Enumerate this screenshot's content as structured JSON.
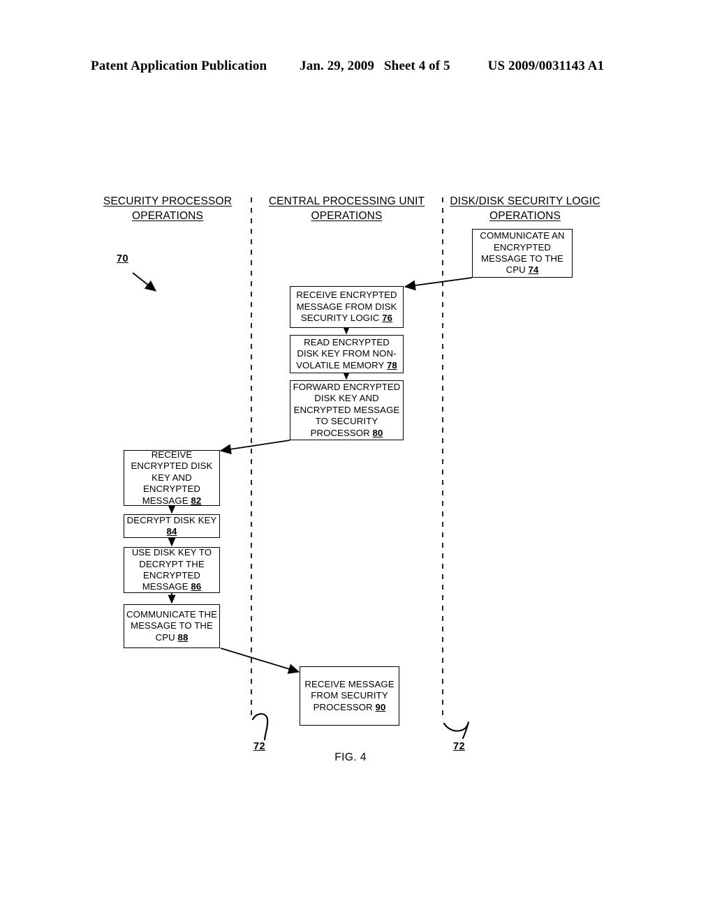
{
  "header": {
    "publication": "Patent Application Publication",
    "date": "Jan. 29, 2009",
    "sheet": "Sheet 4 of 5",
    "number": "US 2009/0031143 A1"
  },
  "figure": {
    "caption": "FIG. 4",
    "diagram_ref": "70",
    "break_ref_left": "72",
    "break_ref_right": "72",
    "lanes": [
      {
        "id": "security-processor",
        "line1": "SECURITY PROCESSOR",
        "line2": "OPERATIONS"
      },
      {
        "id": "central-processing-unit",
        "line1": "CENTRAL PROCESSING UNIT",
        "line2": "OPERATIONS"
      },
      {
        "id": "disk-security-logic",
        "line1": "DISK/DISK SECURITY LOGIC",
        "line2": "OPERATIONS"
      }
    ],
    "boxes": [
      {
        "ref": "74",
        "lane": "disk-security-logic",
        "lines": [
          "COMMUNICATE AN",
          "ENCRYPTED",
          "MESSAGE TO THE",
          "CPU"
        ]
      },
      {
        "ref": "76",
        "lane": "central-processing-unit",
        "lines": [
          "RECEIVE ENCRYPTED",
          "MESSAGE FROM DISK",
          "SECURITY LOGIC"
        ]
      },
      {
        "ref": "78",
        "lane": "central-processing-unit",
        "lines": [
          "READ ENCRYPTED",
          "DISK KEY FROM NON-",
          "VOLATILE MEMORY"
        ]
      },
      {
        "ref": "80",
        "lane": "central-processing-unit",
        "lines": [
          "FORWARD ENCRYPTED",
          "DISK KEY AND",
          "ENCRYPTED MESSAGE",
          "TO SECURITY",
          "PROCESSOR"
        ]
      },
      {
        "ref": "82",
        "lane": "security-processor",
        "lines": [
          "RECEIVE",
          "ENCRYPTED DISK",
          "KEY AND",
          "ENCRYPTED",
          "MESSAGE"
        ]
      },
      {
        "ref": "84",
        "lane": "security-processor",
        "lines": [
          "DECRYPT DISK KEY"
        ]
      },
      {
        "ref": "86",
        "lane": "security-processor",
        "lines": [
          "USE DISK KEY TO",
          "DECRYPT THE",
          "ENCRYPTED",
          "MESSAGE"
        ]
      },
      {
        "ref": "88",
        "lane": "security-processor",
        "lines": [
          "COMMUNICATE THE",
          "MESSAGE TO THE",
          "CPU"
        ]
      },
      {
        "ref": "90",
        "lane": "central-processing-unit",
        "lines": [
          "RECEIVE MESSAGE",
          "FROM SECURITY",
          "PROCESSOR"
        ]
      }
    ],
    "flow": [
      {
        "from": "74",
        "to": "76",
        "kind": "cross-lane"
      },
      {
        "from": "76",
        "to": "78",
        "kind": "vertical"
      },
      {
        "from": "78",
        "to": "80",
        "kind": "vertical"
      },
      {
        "from": "80",
        "to": "82",
        "kind": "cross-lane"
      },
      {
        "from": "82",
        "to": "84",
        "kind": "vertical"
      },
      {
        "from": "84",
        "to": "86",
        "kind": "vertical"
      },
      {
        "from": "86",
        "to": "88",
        "kind": "vertical"
      },
      {
        "from": "88",
        "to": "90",
        "kind": "cross-lane"
      }
    ]
  }
}
